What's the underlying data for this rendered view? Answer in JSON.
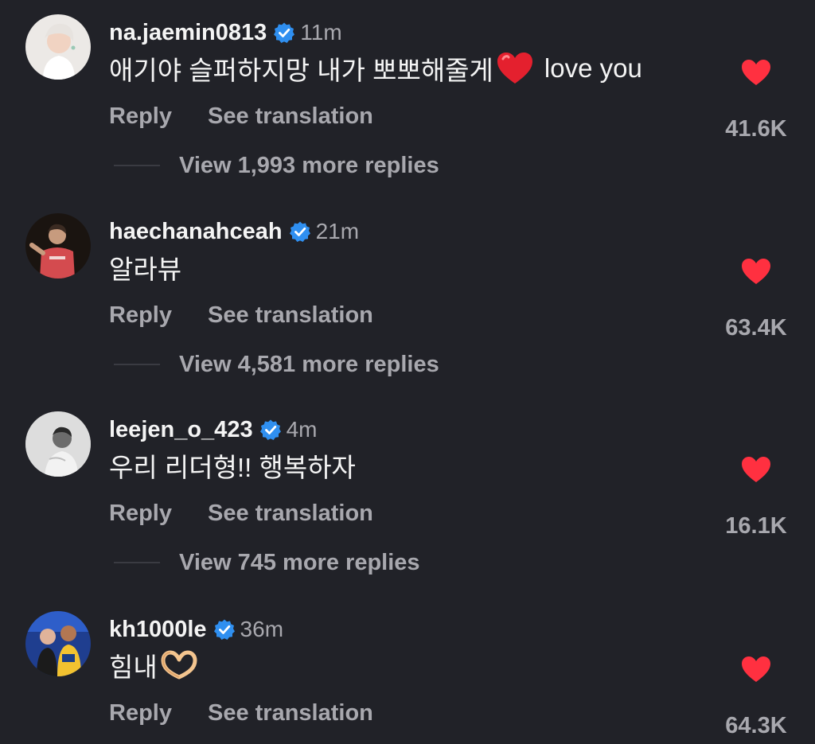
{
  "comments": [
    {
      "username": "na.jaemin0813",
      "time": "11m",
      "text": "애기야 슬퍼하지망 내가 뽀뽀해줄게",
      "text_after_emoji": "love you",
      "emoji": "red-heart",
      "reply_label": "Reply",
      "translate_label": "See translation",
      "likes": "41.6K",
      "view_replies": "View 1,993 more replies",
      "avatar": "avatar-light"
    },
    {
      "username": "haechanahceah",
      "time": "21m",
      "text": "알라뷰",
      "reply_label": "Reply",
      "translate_label": "See translation",
      "likes": "63.4K",
      "view_replies": "View 4,581 more replies",
      "avatar": "avatar-dark-red"
    },
    {
      "username": "leejen_o_423",
      "time": "4m",
      "text": "우리 리더형!! 행복하자",
      "reply_label": "Reply",
      "translate_label": "See translation",
      "likes": "16.1K",
      "view_replies": "View 745 more replies",
      "avatar": "avatar-grayscale"
    },
    {
      "username": "kh1000le",
      "time": "36m",
      "text": "힘내",
      "emoji": "heart-hands",
      "reply_label": "Reply",
      "translate_label": "See translation",
      "likes": "64.3K",
      "avatar": "avatar-blue"
    }
  ],
  "colors": {
    "background": "#212228",
    "verified": "#2f8ff0",
    "like_heart": "#ff3040",
    "muted_text": "#a8a8ae"
  }
}
